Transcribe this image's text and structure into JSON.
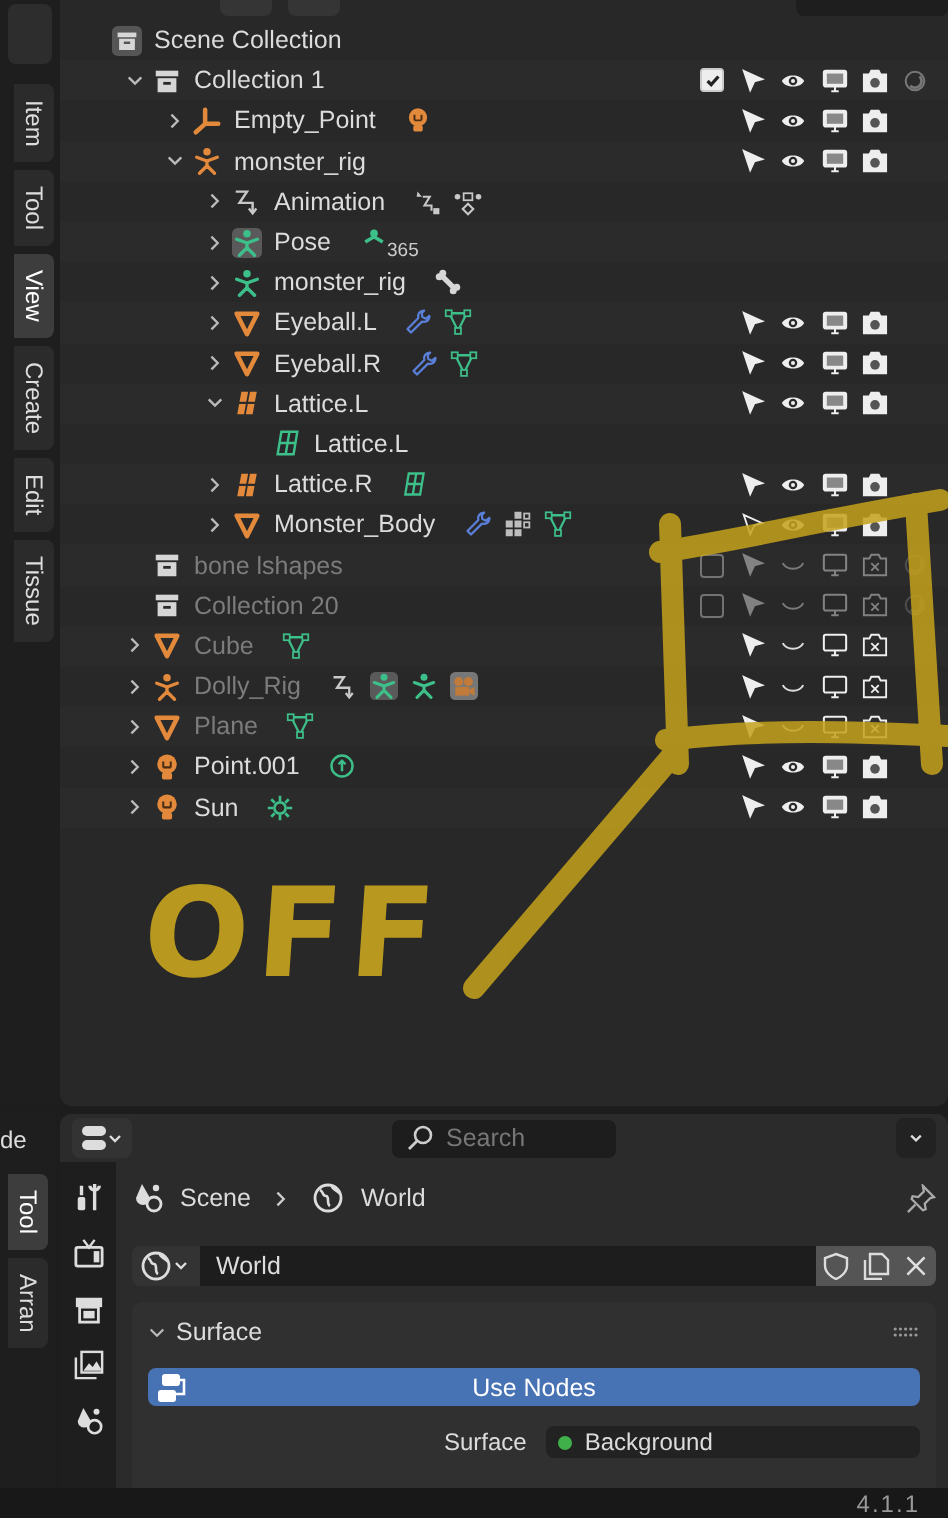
{
  "side_tabs": [
    {
      "label": "Item",
      "selected": false
    },
    {
      "label": "Tool",
      "selected": false
    },
    {
      "label": "View",
      "selected": true
    },
    {
      "label": "Create",
      "selected": false
    },
    {
      "label": "Edit",
      "selected": false
    },
    {
      "label": "Tissue",
      "selected": false
    }
  ],
  "outliner": {
    "tree": [
      {
        "name": "Scene Collection",
        "kind": "scene_collection",
        "children": [
          {
            "name": "Collection 1",
            "kind": "collection",
            "expanded": true,
            "toggles": {
              "checkbox": true,
              "selectable": true,
              "visible": true,
              "viewport": true,
              "render": true,
              "holdout": false
            },
            "children": [
              {
                "name": "Empty_Point",
                "kind": "empty",
                "expanded": false,
                "extras": [
                  {
                    "kind": "light"
                  }
                ],
                "toggles": {
                  "selectable": true,
                  "visible": true,
                  "viewport": true,
                  "render": true
                }
              },
              {
                "name": "monster_rig",
                "kind": "armature",
                "expanded": true,
                "toggles": {
                  "selectable": true,
                  "visible": true,
                  "viewport": true,
                  "render": true
                },
                "children": [
                  {
                    "name": "Animation",
                    "kind": "action",
                    "expanded": false,
                    "extras": [
                      {
                        "kind": "fcurve"
                      },
                      {
                        "kind": "driver"
                      }
                    ]
                  },
                  {
                    "name": "Pose",
                    "kind": "pose",
                    "expanded": false,
                    "extras": [
                      {
                        "kind": "bone_group",
                        "text": "365"
                      }
                    ]
                  },
                  {
                    "name": "monster_rig",
                    "kind": "armature_data",
                    "expanded": false,
                    "extras": [
                      {
                        "kind": "bone"
                      }
                    ]
                  },
                  {
                    "name": "Eyeball.L",
                    "kind": "mesh",
                    "expanded": false,
                    "extras": [
                      {
                        "kind": "wrench"
                      },
                      {
                        "kind": "mesh_data"
                      }
                    ],
                    "toggles": {
                      "selectable": true,
                      "visible": true,
                      "viewport": true,
                      "render": true
                    }
                  },
                  {
                    "name": "Eyeball.R",
                    "kind": "mesh",
                    "expanded": false,
                    "extras": [
                      {
                        "kind": "wrench"
                      },
                      {
                        "kind": "mesh_data"
                      }
                    ],
                    "toggles": {
                      "selectable": true,
                      "visible": true,
                      "viewport": true,
                      "render": true
                    }
                  },
                  {
                    "name": "Lattice.L",
                    "kind": "lattice",
                    "expanded": true,
                    "toggles": {
                      "selectable": true,
                      "visible": true,
                      "viewport": true,
                      "render": true
                    },
                    "children": [
                      {
                        "name": "Lattice.L",
                        "kind": "lattice_data"
                      }
                    ]
                  },
                  {
                    "name": "Lattice.R",
                    "kind": "lattice",
                    "expanded": false,
                    "extras": [
                      {
                        "kind": "lattice_data"
                      }
                    ],
                    "toggles": {
                      "selectable": true,
                      "visible": true,
                      "viewport": true,
                      "render": true
                    }
                  },
                  {
                    "name": "Monster_Body",
                    "kind": "mesh",
                    "expanded": false,
                    "extras": [
                      {
                        "kind": "wrench"
                      },
                      {
                        "kind": "vertex_groups"
                      },
                      {
                        "kind": "mesh_data"
                      }
                    ],
                    "toggles": {
                      "selectable": false,
                      "visible": true,
                      "viewport": true,
                      "render": true
                    }
                  }
                ]
              }
            ]
          },
          {
            "name": "bone lshapes",
            "kind": "collection",
            "dimmed": true,
            "toggles": {
              "checkbox": false,
              "selectable": true,
              "visible": false,
              "viewport": false,
              "render": false,
              "holdout": false
            }
          },
          {
            "name": "Collection 20",
            "kind": "collection",
            "dimmed": true,
            "toggles": {
              "checkbox": false,
              "selectable": true,
              "visible": false,
              "viewport": false,
              "render": false,
              "holdout": false
            }
          },
          {
            "name": "Cube",
            "kind": "mesh",
            "expanded": false,
            "dimmed": true,
            "extras": [
              {
                "kind": "mesh_data"
              }
            ],
            "toggles": {
              "selectable": true,
              "visible": false,
              "viewport": false,
              "render": false
            }
          },
          {
            "name": "Dolly_Rig",
            "kind": "armature",
            "expanded": false,
            "dimmed": true,
            "extras": [
              {
                "kind": "action"
              },
              {
                "kind": "pose"
              },
              {
                "kind": "armature_data"
              },
              {
                "kind": "camera_data"
              }
            ],
            "toggles": {
              "selectable": true,
              "visible": false,
              "viewport": false,
              "render": false
            }
          },
          {
            "name": "Plane",
            "kind": "mesh",
            "expanded": false,
            "dimmed": true,
            "extras": [
              {
                "kind": "mesh_data"
              }
            ],
            "toggles": {
              "selectable": true,
              "visible": false,
              "viewport": false,
              "render": false
            }
          },
          {
            "name": "Point.001",
            "kind": "light",
            "expanded": false,
            "extras": [
              {
                "kind": "point_light"
              }
            ],
            "toggles": {
              "selectable": true,
              "visible": true,
              "viewport": true,
              "render": true
            }
          },
          {
            "name": "Sun",
            "kind": "light",
            "expanded": false,
            "extras": [
              {
                "kind": "sun_light"
              }
            ],
            "toggles": {
              "selectable": true,
              "visible": true,
              "viewport": true,
              "render": true
            }
          }
        ]
      }
    ]
  },
  "annotation": {
    "text": "OFF"
  },
  "side_strip": {
    "header_text": "de",
    "tabs": [
      {
        "label": "Tool",
        "selected": true
      },
      {
        "label": "Arran",
        "selected": false
      }
    ]
  },
  "properties": {
    "search": {
      "placeholder": "Search"
    },
    "breadcrumb": [
      "Scene",
      "World"
    ],
    "world_field": {
      "value": "World"
    },
    "panel": {
      "title": "Surface",
      "expanded": true,
      "button": "Use Nodes",
      "row_label": "Surface",
      "row_value": "Background"
    }
  },
  "status_bar": {
    "version": "4.1.1"
  }
}
